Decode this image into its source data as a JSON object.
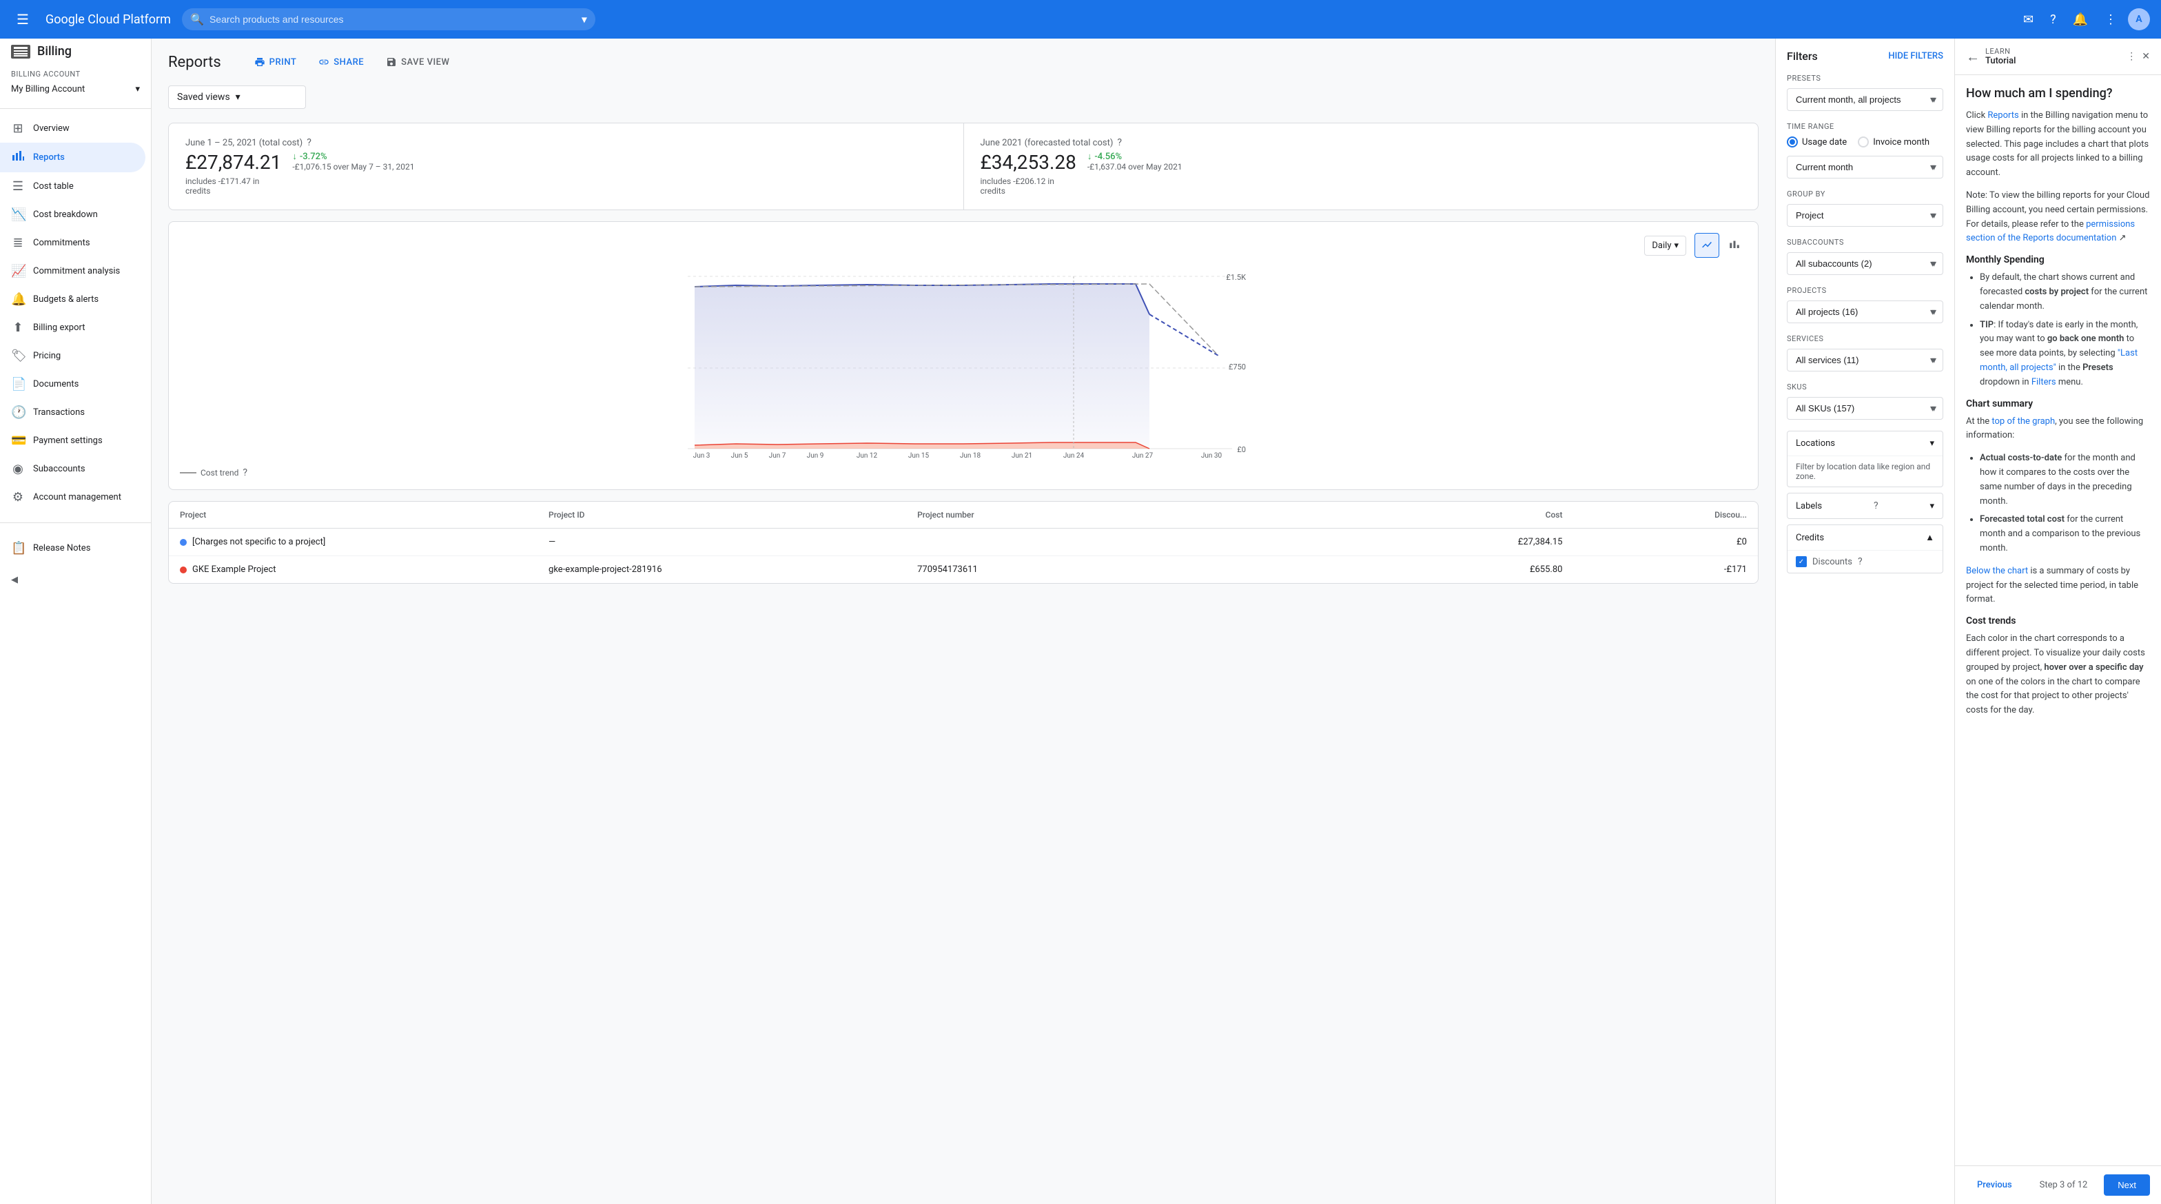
{
  "topnav": {
    "logo": "Google Cloud Platform",
    "search_placeholder": "Search products and resources",
    "menu_icon": "≡",
    "dropdown_icon": "▾"
  },
  "sidebar": {
    "brand": "Billing",
    "billing_account_label": "Billing account",
    "billing_account_name": "My Billing Account",
    "nav_items": [
      {
        "id": "overview",
        "label": "Overview",
        "icon": "⊞"
      },
      {
        "id": "reports",
        "label": "Reports",
        "icon": "📊",
        "active": true
      },
      {
        "id": "cost-table",
        "label": "Cost table",
        "icon": "☰"
      },
      {
        "id": "cost-breakdown",
        "label": "Cost breakdown",
        "icon": "📉"
      },
      {
        "id": "commitments",
        "label": "Commitments",
        "icon": "≣"
      },
      {
        "id": "commitment-analysis",
        "label": "Commitment analysis",
        "icon": "📈"
      },
      {
        "id": "budgets-alerts",
        "label": "Budgets & alerts",
        "icon": "🔔"
      },
      {
        "id": "billing-export",
        "label": "Billing export",
        "icon": "⬆"
      },
      {
        "id": "pricing",
        "label": "Pricing",
        "icon": "🏷"
      },
      {
        "id": "documents",
        "label": "Documents",
        "icon": "📄"
      },
      {
        "id": "transactions",
        "label": "Transactions",
        "icon": "🕐"
      },
      {
        "id": "payment-settings",
        "label": "Payment settings",
        "icon": "💳"
      },
      {
        "id": "subaccounts",
        "label": "Subaccounts",
        "icon": "◉"
      },
      {
        "id": "account-management",
        "label": "Account management",
        "icon": "⚙"
      }
    ],
    "footer_items": [
      {
        "id": "release-notes",
        "label": "Release Notes",
        "icon": "📋"
      }
    ],
    "collapse_icon": "◀"
  },
  "reports": {
    "title": "Reports",
    "actions": {
      "print": "PRINT",
      "share": "SHARE",
      "save_view": "SAVE VIEW"
    },
    "saved_views_label": "Saved views",
    "summary": {
      "actual": {
        "title": "June 1 – 25, 2021 (total cost)",
        "amount": "£27,874.21",
        "sub1": "includes -£171.47 in",
        "sub2": "credits",
        "change": "-3.72%",
        "change_detail": "-£1,076.15 over May 7 – 31, 2021"
      },
      "forecast": {
        "title": "June 2021 (forecasted total cost)",
        "amount": "£34,253.28",
        "sub1": "includes -£206.12 in",
        "sub2": "credits",
        "change": "-4.56%",
        "change_detail": "-£1,637.04 over May 2021"
      }
    },
    "chart": {
      "granularity": "Daily",
      "y_labels": [
        "£1.5K",
        "£750",
        "£0"
      ],
      "x_labels": [
        "Jun 3",
        "Jun 5",
        "Jun 7",
        "Jun 9",
        "Jun 12",
        "Jun 15",
        "Jun 18",
        "Jun 21",
        "Jun 24",
        "Jun 27",
        "Jun 30"
      ],
      "legend": "Cost trend"
    },
    "table": {
      "columns": [
        "Project",
        "Project ID",
        "Project number",
        "Cost",
        "Discounts"
      ],
      "rows": [
        {
          "color": "#4285f4",
          "project": "[Charges not specific to a project]",
          "project_id": "—",
          "project_number": "",
          "cost": "£27,384.15",
          "discount": "£0"
        },
        {
          "color": "#ea4335",
          "project": "GKE Example Project",
          "project_id": "gke-example-project-281916",
          "project_number": "770954173611",
          "cost": "£655.80",
          "discount": "-£171"
        }
      ]
    }
  },
  "filters": {
    "title": "Filters",
    "hide_btn": "HIDE FILTERS",
    "presets": {
      "label": "Presets",
      "value": "Current month, all projects"
    },
    "time_range": {
      "label": "Time range",
      "options": [
        "Usage date",
        "Invoice month"
      ],
      "selected": "Usage date",
      "period_label": "Current month"
    },
    "group_by": {
      "label": "Group by",
      "value": "Project"
    },
    "subaccounts": {
      "label": "Subaccounts",
      "value": "All subaccounts (2)"
    },
    "projects": {
      "label": "Projects",
      "value": "All projects (16)"
    },
    "services": {
      "label": "Services",
      "value": "All services (11)"
    },
    "skus": {
      "label": "SKUs",
      "value": "All SKUs (157)"
    },
    "locations": {
      "label": "Locations",
      "sub": "Filter by location data like region and zone.",
      "collapsed": true
    },
    "labels": {
      "label": "Labels",
      "collapsed": true
    },
    "credits": {
      "label": "Credits",
      "discounts_label": "Discounts",
      "discounts_checked": true,
      "collapsed": false
    }
  },
  "tutorial": {
    "back_icon": "←",
    "learn_label": "LEARN",
    "title": "Tutorial",
    "more_icon": "⋮",
    "close_icon": "✕",
    "main_title": "How much am I spending?",
    "intro_text_1": "Click ",
    "intro_link": "Reports",
    "intro_text_2": " in the Billing navigation menu to view Billing reports for the billing account you selected. This page includes a chart that plots usage costs for all projects linked to a billing account.",
    "note_text": "Note: To view the billing reports for your Cloud Billing account, you need certain permissions. For details, please refer to the ",
    "note_link": "permissions section of the Reports documentation",
    "monthly_spending_title": "Monthly Spending",
    "monthly_items": [
      "By default, the chart shows current and forecasted costs by project for the current calendar month.",
      "TIP: If today's date is early in the month, you may want to go back one month to see more data points, by selecting \"Last month, all projects\" in the Presets dropdown in Filters menu."
    ],
    "chart_summary_title": "Chart summary",
    "chart_summary_intro": "At the top of the graph, you see the following information:",
    "chart_summary_items": [
      "Actual costs-to-date for the month and how it compares to the costs over the same number of days in the preceding month.",
      "Forecasted total cost for the current month and a comparison to the previous month."
    ],
    "below_chart_text": "Below the chart is a summary of costs by project for the selected time period, in table format.",
    "cost_trends_title": "Cost trends",
    "cost_trends_text": "Each color in the chart corresponds to a different project. To visualize your daily costs grouped by project, hover over a specific day on one of the colors in the chart to compare the cost for that project to other projects' costs for the day.",
    "footer": {
      "prev_label": "Previous",
      "step_label": "Step 3 of 12",
      "next_label": "Next"
    }
  }
}
